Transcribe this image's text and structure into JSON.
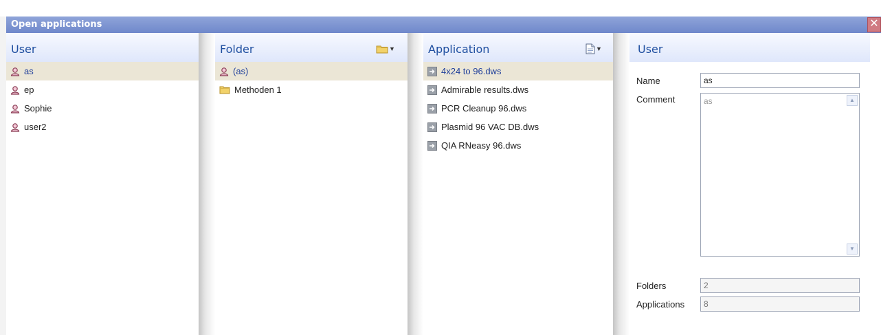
{
  "window": {
    "title": "Open applications",
    "close_icon": "close-icon"
  },
  "users_panel": {
    "header": "User",
    "items": [
      {
        "label": "as",
        "icon": "user-icon",
        "selected": true
      },
      {
        "label": "ep",
        "icon": "user-icon",
        "selected": false
      },
      {
        "label": "Sophie",
        "icon": "user-icon",
        "selected": false
      },
      {
        "label": "user2",
        "icon": "user-icon",
        "selected": false
      }
    ]
  },
  "folder_panel": {
    "header": "Folder",
    "menu_icon": "folder-menu-icon",
    "items": [
      {
        "label": "(as)",
        "icon": "user-icon",
        "selected": true
      },
      {
        "label": "Methoden 1",
        "icon": "folder-icon",
        "selected": false
      }
    ]
  },
  "application_panel": {
    "header": "Application",
    "menu_icon": "document-menu-icon",
    "items": [
      {
        "label": "4x24 to 96.dws",
        "icon": "app-file-icon",
        "selected": true
      },
      {
        "label": "Admirable results.dws",
        "icon": "app-file-icon",
        "selected": false
      },
      {
        "label": "PCR Cleanup 96.dws",
        "icon": "app-file-icon",
        "selected": false
      },
      {
        "label": "Plasmid 96 VAC DB.dws",
        "icon": "app-file-icon",
        "selected": false
      },
      {
        "label": "QIA RNeasy 96.dws",
        "icon": "app-file-icon",
        "selected": false
      }
    ]
  },
  "detail_panel": {
    "header": "User",
    "name_label": "Name",
    "name_value": "as",
    "comment_label": "Comment",
    "comment_value": "as",
    "folders_label": "Folders",
    "folders_value": "2",
    "applications_label": "Applications",
    "applications_value": "8"
  },
  "colors": {
    "titlebar": "#7b92d1",
    "header_text": "#1f4fa0",
    "selection": "#ebe6d6",
    "close": "#d07a82"
  }
}
